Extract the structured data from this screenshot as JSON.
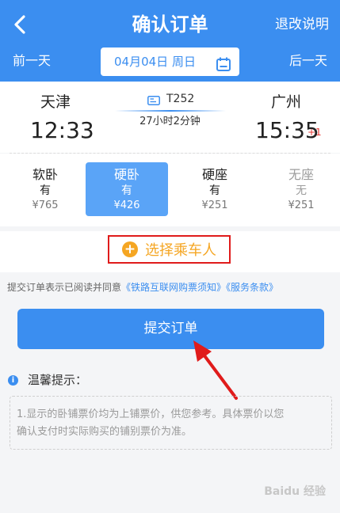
{
  "header": {
    "title": "确认订单",
    "refund_label": "退改说明",
    "prev_day": "前一天",
    "next_day": "后一天",
    "date_text": "04月04日 周日"
  },
  "train": {
    "from_city": "天津",
    "to_city": "广州",
    "dep_time": "12:33",
    "arr_time": "15:35",
    "arr_plus_day": "+1",
    "train_no": "T252",
    "duration": "27小时2分钟"
  },
  "seats": [
    {
      "name": "软卧",
      "avail": "有",
      "price": "¥765",
      "state": "normal"
    },
    {
      "name": "硬卧",
      "avail": "有",
      "price": "¥426",
      "state": "selected"
    },
    {
      "name": "硬座",
      "avail": "有",
      "price": "¥251",
      "state": "normal"
    },
    {
      "name": "无座",
      "avail": "无",
      "price": "¥251",
      "state": "disabled"
    }
  ],
  "passenger": {
    "choose_label": "选择乘车人"
  },
  "agreement": {
    "prefix": "提交订单表示已阅读并同意",
    "link1": "《铁路互联网购票须知》",
    "link2": "《服务条款》"
  },
  "submit_label": "提交订单",
  "tips": {
    "title": "温馨提示：",
    "line1": "1.显示的卧铺票价均为上铺票价，供您参考。具体票价以您",
    "line2": "确认支付时实际购买的铺别票价为准。"
  },
  "watermark": "Baidu 经验",
  "colors": {
    "primary": "#3b8ef0",
    "accent_orange": "#f5a623",
    "highlight_red": "#e01b1b"
  }
}
